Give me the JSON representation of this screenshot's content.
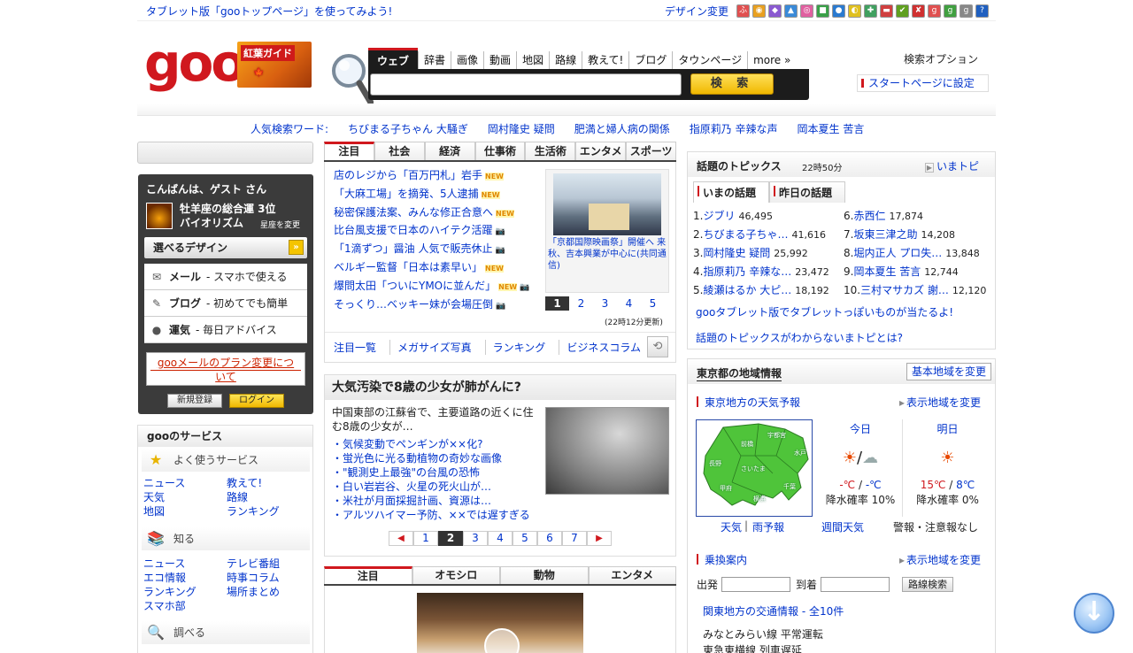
{
  "topbar": {
    "tablet_link": "タブレット版「gooトップページ」を使ってみよう!",
    "design_change": "デザイン変更",
    "icons": [
      {
        "glyph": "ふ",
        "color": "#e05050"
      },
      {
        "glyph": "◉",
        "color": "#e8a020"
      },
      {
        "glyph": "◆",
        "color": "#8a5ad0"
      },
      {
        "glyph": "▲",
        "color": "#3a8ad8"
      },
      {
        "glyph": "◎",
        "color": "#e060a0"
      },
      {
        "glyph": "■",
        "color": "#3aa048"
      },
      {
        "glyph": "●",
        "color": "#2a7ad0"
      },
      {
        "glyph": "◐",
        "color": "#e0c020"
      },
      {
        "glyph": "✚",
        "color": "#40a060"
      },
      {
        "glyph": "▬",
        "color": "#d04040"
      },
      {
        "glyph": "✔",
        "color": "#60a020"
      },
      {
        "glyph": "✘",
        "color": "#d03030"
      },
      {
        "glyph": "g",
        "color": "#e05050"
      },
      {
        "glyph": "g",
        "color": "#40a040"
      },
      {
        "glyph": "g",
        "color": "#888888"
      },
      {
        "glyph": "?",
        "color": "#2060c0"
      }
    ]
  },
  "header": {
    "logo": "goo",
    "koyo_label": "紅葉ガイド",
    "koyo_sub": "星座を変更"
  },
  "search": {
    "tabs": [
      "ウェブ",
      "辞書",
      "画像",
      "動画",
      "地図",
      "路線",
      "教えて!",
      "ブログ",
      "タウンページ",
      "more »"
    ],
    "button": "検 索",
    "options": "検索オプション",
    "startpage": "スタートページに設定"
  },
  "popular": {
    "label": "人気検索ワード:",
    "words": [
      "ちびまる子ちゃん 大騒ぎ",
      "岡村隆史 疑問",
      "肥満と婦人病の関係",
      "指原莉乃 辛辣な声",
      "岡本夏生 苦言"
    ]
  },
  "userbox": {
    "greeting": "こんばんは、ゲスト さん",
    "fortune_line1": "牡羊座の総合運 3位",
    "fortune_line2": "バイオリズム",
    "seiza": "星座を変更",
    "design_select": "選べるデザイン",
    "services": [
      {
        "icon": "✉",
        "name": "メール",
        "desc": "- スマホで使える"
      },
      {
        "icon": "✎",
        "name": "ブログ",
        "desc": "- 初めてでも簡単"
      },
      {
        "icon": "●",
        "name": "運気",
        "desc": "- 毎日アドバイス"
      }
    ],
    "plan_line1": "gooメールのプラン変更につ",
    "plan_line2": "いて",
    "register": "新規登録",
    "login": "ログイン"
  },
  "goo_services": {
    "title": "gooのサービス",
    "cat1": "よく使うサービス",
    "cat1_links": [
      "ニュース",
      "教えて!",
      "天気",
      "路線",
      "地図",
      "ランキング"
    ],
    "cat2": "知る",
    "cat2_links": [
      "ニュース",
      "テレビ番組",
      "エコ情報",
      "時事コラム",
      "ランキング",
      "場所まとめ",
      "スマホ部",
      ""
    ],
    "cat3": "調べる"
  },
  "news": {
    "tabs": [
      "注目",
      "社会",
      "経済",
      "仕事術",
      "生活術",
      "エンタメ",
      "スポーツ"
    ],
    "headlines": [
      {
        "text": "店のレジから「百万円札」岩手",
        "new": true,
        "cam": false
      },
      {
        "text": "「大麻工場」を摘発、5人逮捕",
        "new": true,
        "cam": false
      },
      {
        "text": "秘密保護法案、みんな修正合意へ",
        "new": true,
        "cam": false
      },
      {
        "text": "比台風支援で日本のハイテク活躍",
        "new": false,
        "cam": true
      },
      {
        "text": "「1滴ずつ」醤油 人気で販売休止",
        "new": false,
        "cam": true
      },
      {
        "text": "ベルギー監督「日本は素早い」",
        "new": true,
        "cam": false
      },
      {
        "text": "爆問太田「ついにYMOに並んだ」",
        "new": true,
        "cam": true
      },
      {
        "text": "そっくり…ベッキー妹が会場圧倒",
        "new": false,
        "cam": true
      }
    ],
    "new_label": "NEW",
    "photo_caption_link": "「京都国際映画祭」開催へ 来秋、吉本興業が中心に",
    "photo_caption_src": "(共同通信)",
    "pages": [
      "1",
      "2",
      "3",
      "4",
      "5"
    ],
    "updated": "(22時12分更新)",
    "links": [
      "注目一覧",
      "メガサイズ写真",
      "ランキング",
      "ビジネスコラム"
    ]
  },
  "feature": {
    "title": "大気汚染で8歳の少女が肺がんに?",
    "intro": "中国東部の江蘇省で、主要道路の近くに住む8歳の少女が…",
    "list": [
      "・気候変動でペンギンが××化?",
      "・蛍光色に光る動植物の奇妙な画像",
      "・\"観測史上最強\"の台風の恐怖",
      "・白い岩岩谷、火星の死火山が…",
      "・米社が月面採掘計画、資源は…",
      "・アルツハイマー予防、××では遅すぎる"
    ],
    "pages": [
      "1",
      "2",
      "3",
      "4",
      "5",
      "6",
      "7"
    ],
    "prev": "◀",
    "next": "▶"
  },
  "bottom_tabs": [
    "注目",
    "オモシロ",
    "動物",
    "エンタメ"
  ],
  "topics": {
    "title": "話題のトピックス",
    "time": "22時50分",
    "imatopi": "いまトピ",
    "tabs": [
      "いまの話題",
      "昨日の話題"
    ],
    "ranks": [
      {
        "n": "1.",
        "w": "ジブリ",
        "c": "46,495"
      },
      {
        "n": "6.",
        "w": "赤西仁",
        "c": "17,874"
      },
      {
        "n": "2.",
        "w": "ちびまる子ちゃ…",
        "c": "41,616"
      },
      {
        "n": "7.",
        "w": "坂東三津之助",
        "c": "14,208"
      },
      {
        "n": "3.",
        "w": "岡村隆史 疑問",
        "c": "25,992"
      },
      {
        "n": "8.",
        "w": "堀内正人 プロ失…",
        "c": "13,848"
      },
      {
        "n": "4.",
        "w": "指原莉乃 辛辣な…",
        "c": "23,472"
      },
      {
        "n": "9.",
        "w": "岡本夏生 苦言",
        "c": "12,744"
      },
      {
        "n": "5.",
        "w": "綾瀬はるか 大ピ…",
        "c": "18,192"
      },
      {
        "n": "10.",
        "w": "三村マサカズ 謝…",
        "c": "12,120"
      }
    ],
    "link1": "gooタブレット版でタブレットっぽいものが当たるよ!",
    "link2": "話題のトピックスがわからないまトピとは?"
  },
  "region": {
    "title": "東京都の地域情報",
    "change_base": "基本地域を変更",
    "weather_title": "東京地方の天気予報",
    "change_display": "表示地域を変更",
    "today": {
      "label": "今日",
      "icons": "☀/☁",
      "hi": "-℃",
      "lo": "-℃",
      "rain": "降水確率 10%"
    },
    "tomorrow": {
      "label": "明日",
      "icons": "☀",
      "hi": "15℃",
      "lo": "8℃",
      "rain": "降水確率 0%"
    },
    "wlinks": [
      "天気",
      "雨予報",
      "週間天気",
      "警報・注意報なし"
    ],
    "map_labels": [
      "前橋",
      "宇都宮",
      "水戸",
      "長野",
      "さいたま",
      "千葉",
      "甲府",
      "横浜"
    ],
    "transit_title": "乗換案内",
    "transit_change": "表示地域を変更",
    "from": "出発",
    "to": "到着",
    "route_btn": "路線検索",
    "traffic_title": "関東地方の交通情報 - 全10件",
    "traffic": [
      "みなとみらい線 平常運転",
      "東急東横線 列車遅延"
    ]
  },
  "scroll_button": "↓"
}
